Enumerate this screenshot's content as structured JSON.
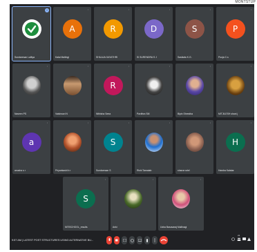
{
  "corner_text": "MONTSTUP",
  "participants": [
    {
      "name": "Sundaresan Lalitya",
      "initial": "",
      "color": "#1e8e3e",
      "type": "check",
      "active": true,
      "pin": "+"
    },
    {
      "name": "Kalai Mallingi",
      "initial": "A",
      "color": "#e8710a",
      "type": "initial"
    },
    {
      "name": "SHILAJA GAYATHRI",
      "initial": "R",
      "color": "#f29900",
      "type": "initial"
    },
    {
      "name": "SI SURENDRA S J",
      "initial": "D",
      "color": "#7b68c8",
      "type": "initial"
    },
    {
      "name": "Sasikala K.G.",
      "initial": "S",
      "color": "#8d5447",
      "type": "initial"
    },
    {
      "name": "Pooja C.s",
      "initial": "P",
      "color": "#f4511e",
      "type": "initial"
    },
    {
      "name": "Naveen PS",
      "initial": "",
      "color": "#5f6368",
      "type": "photo",
      "photo": "gray"
    },
    {
      "name": "Vaishnavi N",
      "initial": "",
      "color": "#5f6368",
      "type": "photo",
      "photo": "brown"
    },
    {
      "name": "Nithisha Seea",
      "initial": "R",
      "color": "#c2185b",
      "type": "initial"
    },
    {
      "name": "Pavithra SM",
      "initial": "",
      "color": "#5f6368",
      "type": "photo",
      "photo": "mono"
    },
    {
      "name": "Bipin Shrestha",
      "initial": "",
      "color": "#5f6368",
      "type": "photo",
      "photo": "purple"
    },
    {
      "name": "MITJILESH shani j",
      "initial": "",
      "color": "#5f6368",
      "type": "photo",
      "photo": "gold"
    },
    {
      "name": "anusha s r",
      "initial": "a",
      "color": "#5e35b1",
      "type": "initial"
    },
    {
      "name": "Priyankashi b r",
      "initial": "",
      "color": "#5f6368",
      "type": "photo",
      "photo": "orange"
    },
    {
      "name": "Sundaresan S",
      "initial": "S",
      "color": "#00838f",
      "type": "initial"
    },
    {
      "name": "Rishi Tamatah",
      "initial": "",
      "color": "#5f6368",
      "type": "photo",
      "photo": "blue"
    },
    {
      "name": "sharon sriel",
      "initial": "",
      "color": "#5f6368",
      "type": "photo",
      "photo": "face"
    },
    {
      "name": "Harsha Kalatar",
      "initial": "H",
      "color": "#0b6e4f",
      "type": "initial"
    },
    {
      "name": "NITISCHOOL_results",
      "initial": "S",
      "color": "#0b6e4f",
      "type": "initial"
    },
    {
      "name": "Anki",
      "initial": "",
      "color": "#5f6368",
      "type": "photo",
      "photo": "green"
    },
    {
      "name": "Usha Basavaraj Mallinagi",
      "initial": "",
      "color": "#5f6368",
      "type": "photo",
      "photo": "saree"
    }
  ],
  "bottom": {
    "meeting_info": "9:57 AM  |  LATEST POST STRUCTURES USING ALTERNATIVE BU...",
    "participant_count": "21"
  }
}
